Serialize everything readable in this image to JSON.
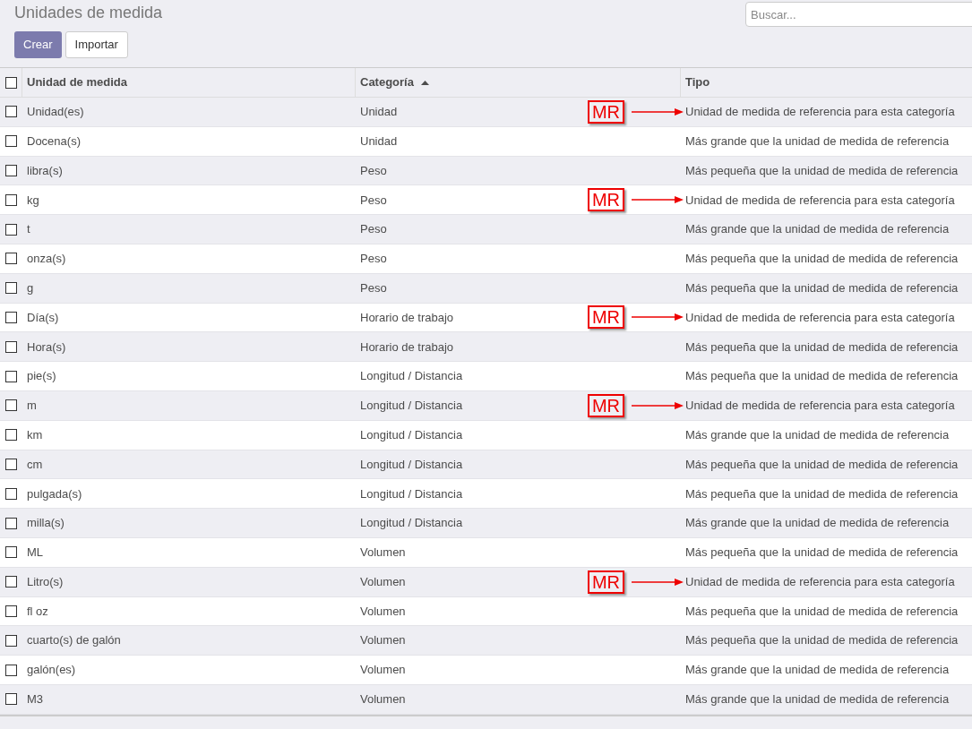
{
  "title": "Unidades de medida",
  "search": {
    "placeholder": "Buscar..."
  },
  "buttons": [
    {
      "label": "Crear",
      "kind": "primary"
    },
    {
      "label": "Importar",
      "kind": "secondary"
    }
  ],
  "select_all": {
    "checked": false
  },
  "columns": [
    {
      "label": "Unidad de medida",
      "sorted": false
    },
    {
      "label": "Categoría",
      "sorted": true
    },
    {
      "label": "Tipo",
      "sorted": false
    }
  ],
  "rows": [
    {
      "name": "Unidad(es)",
      "category": "Unidad",
      "type": "Unidad de medida de referencia para esta categoría",
      "checked": false,
      "annotation": "MR"
    },
    {
      "name": "Docena(s)",
      "category": "Unidad",
      "type": "Más grande que la unidad de medida de referencia",
      "checked": false
    },
    {
      "name": "libra(s)",
      "category": "Peso",
      "type": "Más pequeña que la unidad de medida de referencia",
      "checked": false
    },
    {
      "name": "kg",
      "category": "Peso",
      "type": "Unidad de medida de referencia para esta categoría",
      "checked": false,
      "annotation": "MR"
    },
    {
      "name": "t",
      "category": "Peso",
      "type": "Más grande que la unidad de medida de referencia",
      "checked": false
    },
    {
      "name": "onza(s)",
      "category": "Peso",
      "type": "Más pequeña que la unidad de medida de referencia",
      "checked": false
    },
    {
      "name": "g",
      "category": "Peso",
      "type": "Más pequeña que la unidad de medida de referencia",
      "checked": false
    },
    {
      "name": "Día(s)",
      "category": "Horario de trabajo",
      "type": "Unidad de medida de referencia para esta categoría",
      "checked": false,
      "annotation": "MR"
    },
    {
      "name": "Hora(s)",
      "category": "Horario de trabajo",
      "type": "Más pequeña que la unidad de medida de referencia",
      "checked": false
    },
    {
      "name": "pie(s)",
      "category": "Longitud / Distancia",
      "type": "Más pequeña que la unidad de medida de referencia",
      "checked": false
    },
    {
      "name": "m",
      "category": "Longitud / Distancia",
      "type": "Unidad de medida de referencia para esta categoría",
      "checked": false,
      "annotation": "MR"
    },
    {
      "name": "km",
      "category": "Longitud / Distancia",
      "type": "Más grande que la unidad de medida de referencia",
      "checked": false
    },
    {
      "name": "cm",
      "category": "Longitud / Distancia",
      "type": "Más pequeña que la unidad de medida de referencia",
      "checked": false
    },
    {
      "name": "pulgada(s)",
      "category": "Longitud / Distancia",
      "type": "Más pequeña que la unidad de medida de referencia",
      "checked": false
    },
    {
      "name": "milla(s)",
      "category": "Longitud / Distancia",
      "type": "Más grande que la unidad de medida de referencia",
      "checked": false
    },
    {
      "name": "ML",
      "category": "Volumen",
      "type": "Más pequeña que la unidad de medida de referencia",
      "checked": false
    },
    {
      "name": "Litro(s)",
      "category": "Volumen",
      "type": "Unidad de medida de referencia para esta categoría",
      "checked": false,
      "annotation": "MR"
    },
    {
      "name": "fl oz",
      "category": "Volumen",
      "type": "Más pequeña que la unidad de medida de referencia",
      "checked": false
    },
    {
      "name": "cuarto(s) de galón",
      "category": "Volumen",
      "type": "Más pequeña que la unidad de medida de referencia",
      "checked": false
    },
    {
      "name": "galón(es)",
      "category": "Volumen",
      "type": "Más grande que la unidad de medida de referencia",
      "checked": false
    },
    {
      "name": "M3",
      "category": "Volumen",
      "type": "Más grande que la unidad de medida de referencia",
      "checked": false
    }
  ]
}
